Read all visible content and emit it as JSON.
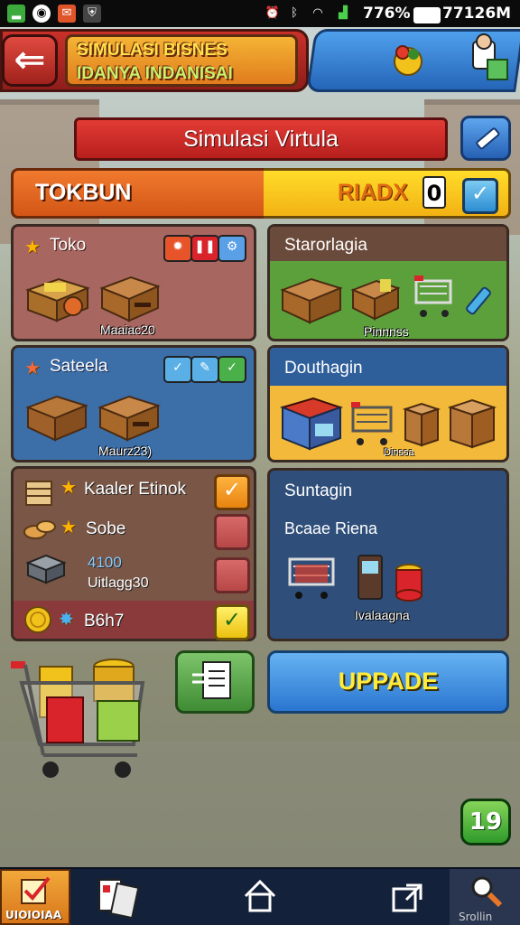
{
  "status_bar": {
    "battery": "776%",
    "time": "77126M"
  },
  "header": {
    "title_line1": "SIMULASI BISNES",
    "title_line2": "IDANYA INDANISAI"
  },
  "banner": {
    "label": "Simulasi Virtula"
  },
  "tabs": {
    "left_label": "TOKBUN",
    "right_label": "RIADX",
    "right_value": "0"
  },
  "panels": {
    "toko": {
      "title": "Toko",
      "caption": "Maaiac20"
    },
    "sateela": {
      "title": "Sateela",
      "caption": "Maurz23)"
    },
    "storage": {
      "title": "Starorlagia",
      "caption": "Pinnnss"
    },
    "douthagin": {
      "title": "Douthagin",
      "caption": "Dinssa"
    },
    "stock_list": {
      "items": [
        {
          "label": "Kaaler Etinok"
        },
        {
          "label": "Sobe"
        },
        {
          "label": "4100",
          "sublabel": "Uitlagg30"
        },
        {
          "label": "B6h7"
        }
      ]
    },
    "suntagin": {
      "title": "Suntagin",
      "subtitle": "Bcaae Riena",
      "caption": "Ivalaagna"
    }
  },
  "buttons": {
    "upgrade": "UPPADE",
    "level": "19"
  },
  "nav": {
    "item_left": "UIOIOIAA",
    "item_right": "Srollin"
  },
  "colors": {
    "header_red": "#c8312a",
    "header_blue": "#2565b8",
    "tab_orange": "#e06a20",
    "tab_yellow": "#f6c41a",
    "panel_red": "#a0605a",
    "panel_green": "#5ca03c",
    "panel_blue": "#3a6ea8",
    "panel_orange": "#f2b93a",
    "panel_navy": "#2f4f7a"
  }
}
